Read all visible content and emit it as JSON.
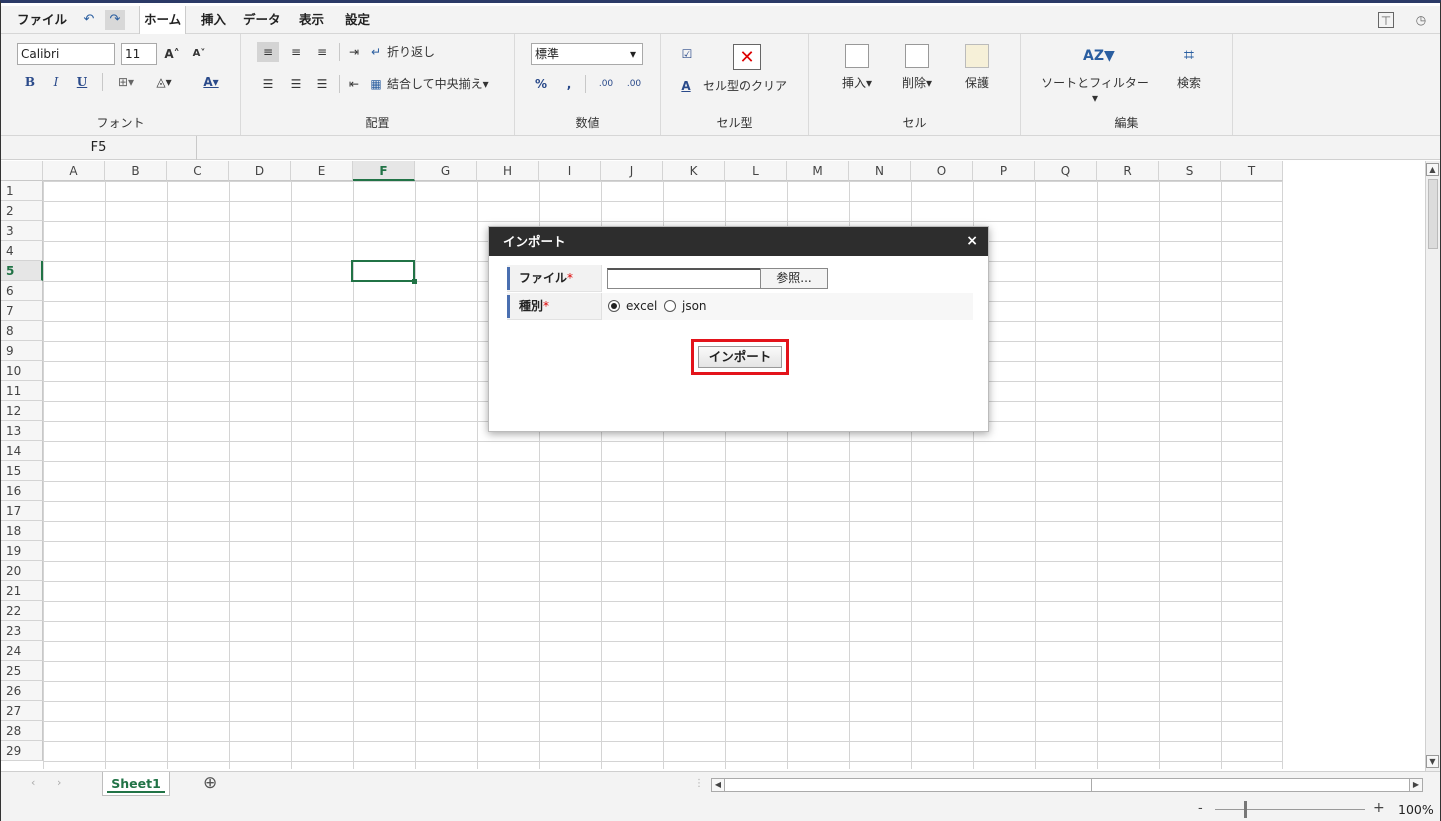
{
  "menu": {
    "file": "ファイル",
    "home": "ホーム",
    "insert": "挿入",
    "data": "データ",
    "view": "表示",
    "settings": "設定"
  },
  "font": {
    "name": "Calibri",
    "size": "11",
    "bold": "B",
    "italic": "I",
    "underline": "U",
    "label": "フォント"
  },
  "align": {
    "wrap": "折り返し",
    "merge": "結合して中央揃え",
    "label": "配置"
  },
  "number": {
    "format": "標準",
    "percent": "%",
    "comma": ",",
    "inc": ".00",
    "label": "数値"
  },
  "style": {
    "clear": "セル型のクリア",
    "label": "セル型"
  },
  "cells": {
    "insert": "挿入",
    "delete": "削除",
    "protect": "保護",
    "label": "セル"
  },
  "edit": {
    "sortfilter": "ソートとフィルター",
    "search": "検索",
    "label": "編集"
  },
  "namebox": "F5",
  "columns": [
    "A",
    "B",
    "C",
    "D",
    "E",
    "F",
    "G",
    "H",
    "I",
    "J",
    "K",
    "L",
    "M",
    "N",
    "O",
    "P",
    "Q",
    "R",
    "S",
    "T"
  ],
  "selected_column": "F",
  "selected_row": 5,
  "rows": [
    1,
    2,
    3,
    4,
    5,
    6,
    7,
    8,
    9,
    10,
    11,
    12,
    13,
    14,
    15,
    16,
    17,
    18,
    19,
    20,
    21,
    22,
    23,
    24,
    25,
    26,
    27,
    28,
    29
  ],
  "sheet": {
    "name": "Sheet1",
    "add": "⊕"
  },
  "zoom": {
    "minus": "-",
    "plus": "+",
    "value": "100%"
  },
  "dialog": {
    "title": "インポート",
    "close": "×",
    "file_label": "ファイル",
    "required": "*",
    "browse": "参照...",
    "type_label": "種別",
    "options": [
      "excel",
      "json"
    ],
    "selected_option": "excel",
    "import_button": "インポート"
  },
  "colors": {
    "accent": "#217346",
    "dialog_title": "#2d2d2d",
    "highlight": "#e3131b",
    "label_bar": "#4a6fb0"
  }
}
